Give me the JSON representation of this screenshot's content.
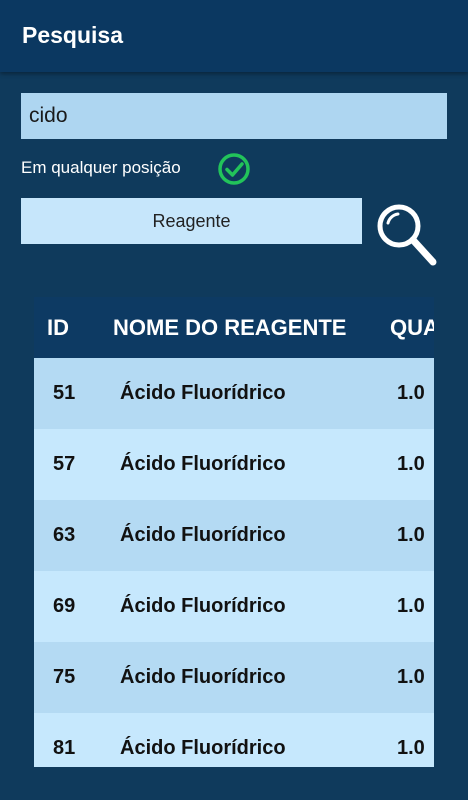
{
  "appbar": {
    "title": "Pesquisa"
  },
  "search": {
    "value": "cido"
  },
  "option": {
    "label": "Em qualquer posição"
  },
  "button": {
    "label": "Reagente"
  },
  "table": {
    "headers": {
      "id": "ID",
      "name": "NOME DO REAGENTE",
      "qty": "QUA"
    },
    "rows": [
      {
        "id": "51",
        "name": "Ácido Fluorídrico",
        "qty": "1.0"
      },
      {
        "id": "57",
        "name": "Ácido Fluorídrico",
        "qty": "1.0"
      },
      {
        "id": "63",
        "name": "Ácido Fluorídrico",
        "qty": "1.0"
      },
      {
        "id": "69",
        "name": "Ácido Fluorídrico",
        "qty": "1.0"
      },
      {
        "id": "75",
        "name": "Ácido Fluorídrico",
        "qty": "1.0"
      },
      {
        "id": "81",
        "name": "Ácido Fluorídrico",
        "qty": "1.0"
      }
    ]
  },
  "colors": {
    "background": "#0f3a5c",
    "appbar": "#0b3861",
    "check": "#22c35a",
    "row_even": "#b4daf3",
    "row_odd": "#c6e8fd"
  },
  "icons": {
    "check": "check-circle-icon",
    "search": "search-icon"
  }
}
